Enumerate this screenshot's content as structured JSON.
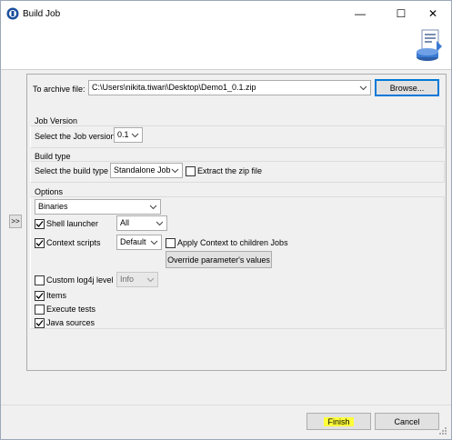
{
  "window": {
    "title": "Build Job",
    "minimize_glyph": "—",
    "maximize_glyph": "☐",
    "close_glyph": "✕"
  },
  "archive": {
    "label": "To archive file:",
    "value": "C:\\Users\\nikita.tiwari\\Desktop\\Demo1_0.1.zip",
    "browse_label": "Browse..."
  },
  "job_version": {
    "group_label": "Job Version",
    "label": "Select the Job version",
    "value": "0.1"
  },
  "build_type": {
    "group_label": "Build type",
    "label": "Select the build type",
    "value": "Standalone Job",
    "extract_label": "Extract the zip file",
    "extract_checked": false
  },
  "options": {
    "group_label": "Options",
    "binaries_value": "Binaries",
    "shell_launcher_label": "Shell launcher",
    "shell_launcher_checked": true,
    "shell_launcher_value": "All",
    "context_scripts_label": "Context scripts",
    "context_scripts_checked": true,
    "context_scripts_value": "Default",
    "apply_context_label": "Apply Context to children Jobs",
    "apply_context_checked": false,
    "override_label": "Override parameter's values",
    "custom_log4j_label": "Custom log4j level",
    "custom_log4j_checked": false,
    "log4j_value": "Info",
    "items_label": "Items",
    "items_checked": true,
    "execute_tests_label": "Execute tests",
    "execute_tests_checked": false,
    "java_sources_label": "Java sources",
    "java_sources_checked": true
  },
  "side_toggle_label": ">>",
  "footer": {
    "finish_label": "Finish",
    "cancel_label": "Cancel"
  },
  "colors": {
    "highlight": "#ffff3a",
    "focus_border": "#0078d7",
    "app_icon": "#1b4f9c"
  }
}
